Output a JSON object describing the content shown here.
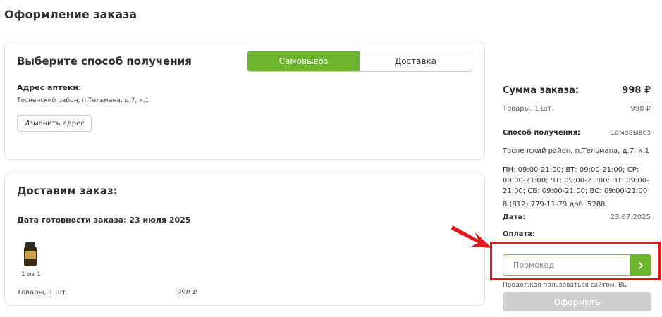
{
  "page": {
    "title": "Оформление заказа"
  },
  "pickup_card": {
    "title": "Выберите способ получения",
    "tabs": [
      {
        "label": "Самовывоз",
        "active": true
      },
      {
        "label": "Доставка",
        "active": false
      }
    ],
    "address_label": "Адрес аптеки:",
    "address_value": "Тосненский район, п.Тельмана, д.7, к.1",
    "change_address": "Изменить адрес"
  },
  "delivery_card": {
    "title": "Доставим заказ:",
    "ready_date": "Дата готовности заказа: 23 июля 2025",
    "product_counter": "1 из 1",
    "goods_label": "Товары, 1 шт.",
    "goods_price": "998 ₽"
  },
  "summary": {
    "title": "Сумма заказа:",
    "total": "998 ₽",
    "goods_label": "Товары, 1 шт.",
    "goods_price": "998 ₽",
    "method_label": "Способ получения:",
    "method_value": "Самовывоз",
    "address": "Тосненский район, п.Тельмана, д.7, к.1",
    "hours_lines": [
      "ПН: 09:00-21:00; ВТ: 09:00-21:00; СР:",
      "09:00-21:00; ЧТ: 09:00-21:00; ПТ: 09:00-",
      "21:00; СБ: 09:00-21:00; ВС: 09:00-21:00"
    ],
    "phone": "8 (812) 779-11-79 доб. 5288",
    "date_label": "Дата:",
    "date_value": "23.07.2025",
    "payment_label": "Оплата:",
    "promo_placeholder": "Промокод",
    "consent_text": "Продолжая пользоваться сайтом, Вы",
    "checkout_label": "Оформить"
  },
  "colors": {
    "accent_green": "#6db52f",
    "highlight_red": "#e3171b",
    "disabled_gray": "#cfcfcf"
  },
  "icons": {
    "promo_submit": "chevron-right-icon",
    "annotation": "red-arrow-icon"
  }
}
